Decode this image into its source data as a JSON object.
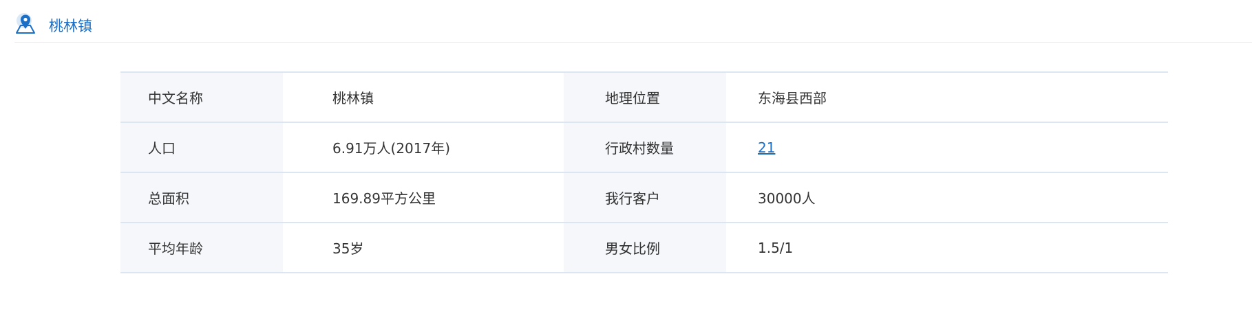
{
  "header": {
    "icon": "map-pin-icon",
    "title": "桃林镇"
  },
  "colors": {
    "accent": "#1a6fc6",
    "label_bg": "#f5f7fa",
    "border": "#dbe6f2"
  },
  "table": {
    "rows": [
      {
        "label1": "中文名称",
        "value1": "桃林镇",
        "label2": "地理位置",
        "value2": "东海县西部"
      },
      {
        "label1": "人口",
        "value1": "6.91万人(2017年)",
        "label2": "行政村数量",
        "value2": "21"
      },
      {
        "label1": "总面积",
        "value1": "169.89平方公里",
        "label2": "我行客户",
        "value2": "30000人"
      },
      {
        "label1": "平均年龄",
        "value1": "35岁",
        "label2": "男女比例",
        "value2": "1.5/1"
      }
    ]
  }
}
